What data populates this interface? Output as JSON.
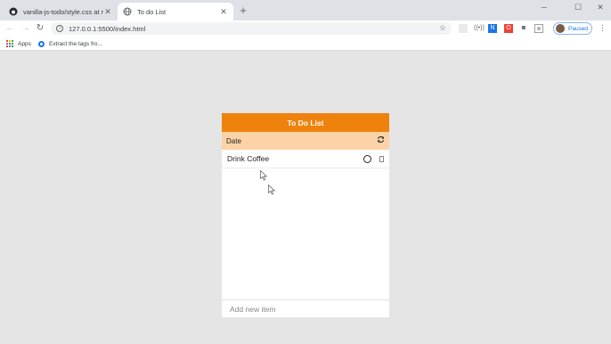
{
  "browser": {
    "tabs": [
      {
        "title": "vanilla-js-todo/style.css at maste",
        "favicon": "github-icon",
        "active": false
      },
      {
        "title": "To do List",
        "favicon": "globe-icon",
        "active": true
      }
    ],
    "url": "127.0.0.1:5500/index.html",
    "profile_label": "Paused",
    "bookmarks": [
      {
        "label": "Apps",
        "icon": "apps-grid-icon"
      },
      {
        "label": "Extract the tags fro...",
        "icon": "extension-circle-icon"
      }
    ]
  },
  "todo": {
    "title": "To Do List",
    "date_label": "Date",
    "items": [
      {
        "text": "Drink Coffee"
      }
    ],
    "input_placeholder": "Add new item"
  },
  "colors": {
    "header": "#ef820d",
    "date_bar": "#fbd3a7",
    "page_background": "#e5e5e5"
  }
}
